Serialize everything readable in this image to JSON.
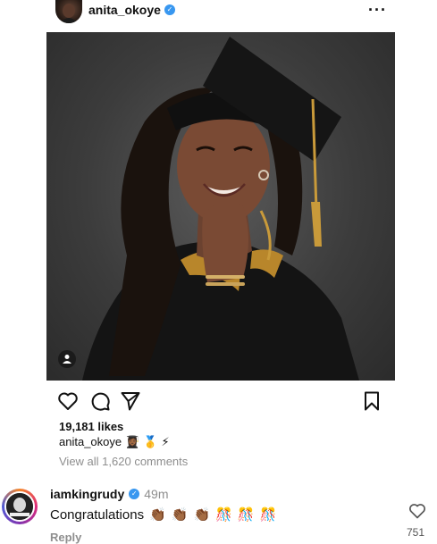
{
  "post": {
    "username": "anita_okoye",
    "verified": true,
    "likes": "19,181 likes",
    "caption_user": "anita_okoye",
    "caption_emojis": [
      "👩🏾‍🎓",
      "🥇",
      "⚡"
    ],
    "view_comments": "View all 1,620 comments"
  },
  "comment": {
    "username": "iamkingrudy",
    "verified": true,
    "time": "49m",
    "text": "Congratulations",
    "emojis": [
      "👏🏾",
      "👏🏾",
      "👏🏾",
      "🎊",
      "🎊",
      "🎊"
    ],
    "reply": "Reply",
    "like_count": "751"
  },
  "icons": {
    "more": "more-options-icon",
    "like": "heart-icon",
    "comment": "comment-icon",
    "share": "share-icon",
    "save": "bookmark-icon",
    "tag": "user-tag-icon"
  },
  "colors": {
    "verified": "#3897f0",
    "secondary_text": "#8e8e8e",
    "story_ring": "#dd2a7b"
  }
}
